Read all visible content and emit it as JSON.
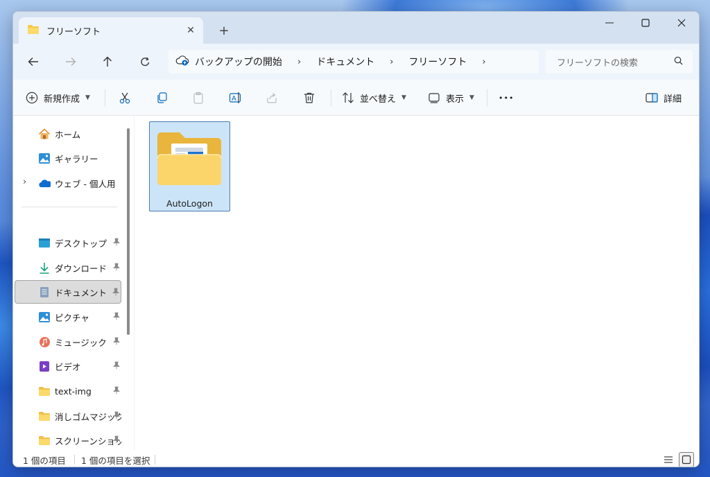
{
  "window": {
    "tab_title": "フリーソフト",
    "tab_close": "✕",
    "new_tab": "+"
  },
  "nav": {
    "breadcrumbs": [
      "バックアップの開始",
      "ドキュメント",
      "フリーソフト"
    ],
    "separator": "›",
    "search_placeholder": "フリーソフトの検索"
  },
  "commands": {
    "new": "新規作成",
    "sort": "並べ替え",
    "view": "表示",
    "more": "•••",
    "details": "詳細"
  },
  "sidebar": {
    "items": [
      {
        "label": "ホーム",
        "icon": "home-icon"
      },
      {
        "label": "ギャラリー",
        "icon": "gallery-icon"
      },
      {
        "label": "ウェブ - 個人用",
        "icon": "onedrive-icon"
      },
      {
        "label": "デスクトップ",
        "icon": "desktop-icon"
      },
      {
        "label": "ダウンロード",
        "icon": "download-icon"
      },
      {
        "label": "ドキュメント",
        "icon": "document-icon"
      },
      {
        "label": "ピクチャ",
        "icon": "picture-icon"
      },
      {
        "label": "ミュージック",
        "icon": "music-icon"
      },
      {
        "label": "ビデオ",
        "icon": "video-icon"
      },
      {
        "label": "text-img",
        "icon": "folder-icon"
      },
      {
        "label": "消しゴムマジック",
        "icon": "folder-icon"
      },
      {
        "label": "スクリーンショット",
        "icon": "folder-icon"
      }
    ],
    "expand": "›"
  },
  "files": [
    {
      "name": "AutoLogon",
      "type": "folder",
      "selected": true
    }
  ],
  "status": {
    "count": "1 個の項目",
    "selected": "1 個の項目を選択"
  },
  "colors": {
    "accent": "#0067c0",
    "selection": "#cce4f7",
    "folder": "#f5c94e"
  }
}
